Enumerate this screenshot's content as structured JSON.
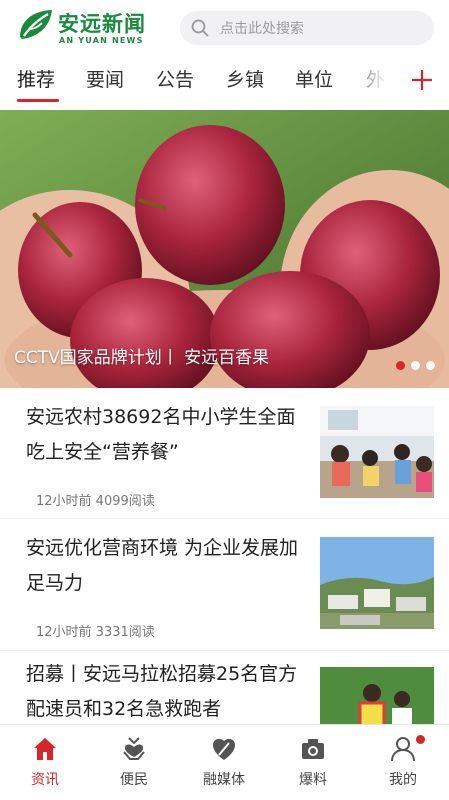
{
  "header": {
    "logo_text": "安远新闻",
    "logo_subtext": "AN YUAN NEWS",
    "search_placeholder": "点击此处搜索"
  },
  "tabs": [
    {
      "label": "推荐",
      "active": true
    },
    {
      "label": "要闻",
      "active": false
    },
    {
      "label": "公告",
      "active": false
    },
    {
      "label": "乡镇",
      "active": false
    },
    {
      "label": "单位",
      "active": false
    },
    {
      "label": "外宣",
      "active": false
    }
  ],
  "banner": {
    "caption": "CCTV国家品牌计划丨 安远百香果",
    "slide_count": 3,
    "active_slide": 1
  },
  "news": [
    {
      "title": "安远农村38692名中小学生全面吃上安全“营养餐”",
      "meta": "12小时前 4099阅读"
    },
    {
      "title": "安远优化营商环境 为企业发展加足马力",
      "meta": "12小时前 3331阅读"
    },
    {
      "title": "招募丨安远马拉松招募25名官方配速员和32名急救跑者",
      "meta": ""
    }
  ],
  "bottom_nav": [
    {
      "label": "资讯",
      "icon": "home-icon",
      "active": true
    },
    {
      "label": "便民",
      "icon": "heart-hand-icon",
      "active": false
    },
    {
      "label": "融媒体",
      "icon": "media-icon",
      "active": false
    },
    {
      "label": "爆料",
      "icon": "camera-icon",
      "active": false
    },
    {
      "label": "我的",
      "icon": "user-icon",
      "active": false,
      "badge": true
    }
  ],
  "colors": {
    "brand_green": "#1a8a3c",
    "accent_red": "#d8242b"
  }
}
